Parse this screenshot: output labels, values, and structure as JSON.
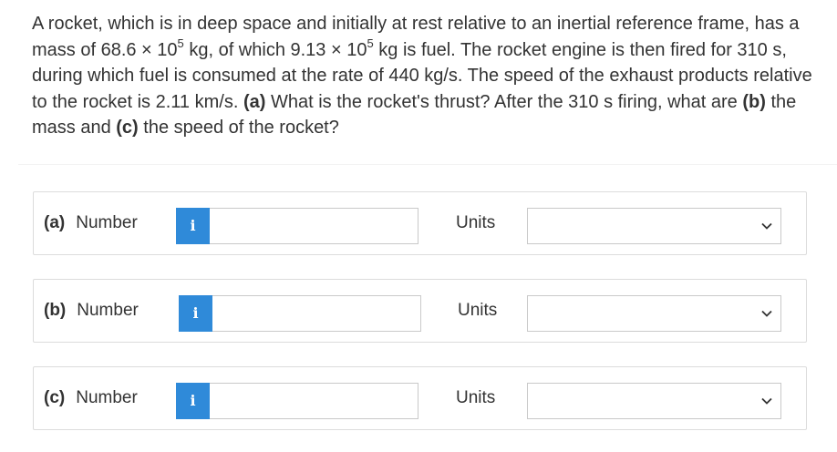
{
  "question": {
    "segments": [
      {
        "t": "A rocket, which is in deep space and initially at rest relative to an inertial reference frame, has a mass of 68.6 × 10"
      },
      {
        "t": "5",
        "sup": true
      },
      {
        "t": " kg, of which 9.13 × 10"
      },
      {
        "t": "5",
        "sup": true
      },
      {
        "t": " kg is fuel. The rocket engine is then fired for 310 s, during which fuel is consumed at the rate of 440 kg/s. The speed of the exhaust products relative to the rocket is 2.11 km/s. "
      },
      {
        "t": "(a)",
        "bold": true
      },
      {
        "t": " What is the rocket's thrust? After the 310 s firing, what are "
      },
      {
        "t": "(b)",
        "bold": true
      },
      {
        "t": " the mass and "
      },
      {
        "t": "(c)",
        "bold": true
      },
      {
        "t": " the speed of the rocket?"
      }
    ]
  },
  "answers": [
    {
      "part": "(a)",
      "number_label": "Number",
      "info_glyph": "i",
      "number_value": "",
      "units_label": "Units",
      "units_selected": ""
    },
    {
      "part": "(b)",
      "number_label": "Number",
      "info_glyph": "i",
      "number_value": "",
      "units_label": "Units",
      "units_selected": ""
    },
    {
      "part": "(c)",
      "number_label": "Number",
      "info_glyph": "i",
      "number_value": "",
      "units_label": "Units",
      "units_selected": ""
    }
  ],
  "colors": {
    "info_button": "#2f8ad9",
    "text": "#333333",
    "border": "#dcdcdc"
  },
  "icons": {
    "info": "info-icon",
    "dropdown": "chevron-down-icon"
  }
}
